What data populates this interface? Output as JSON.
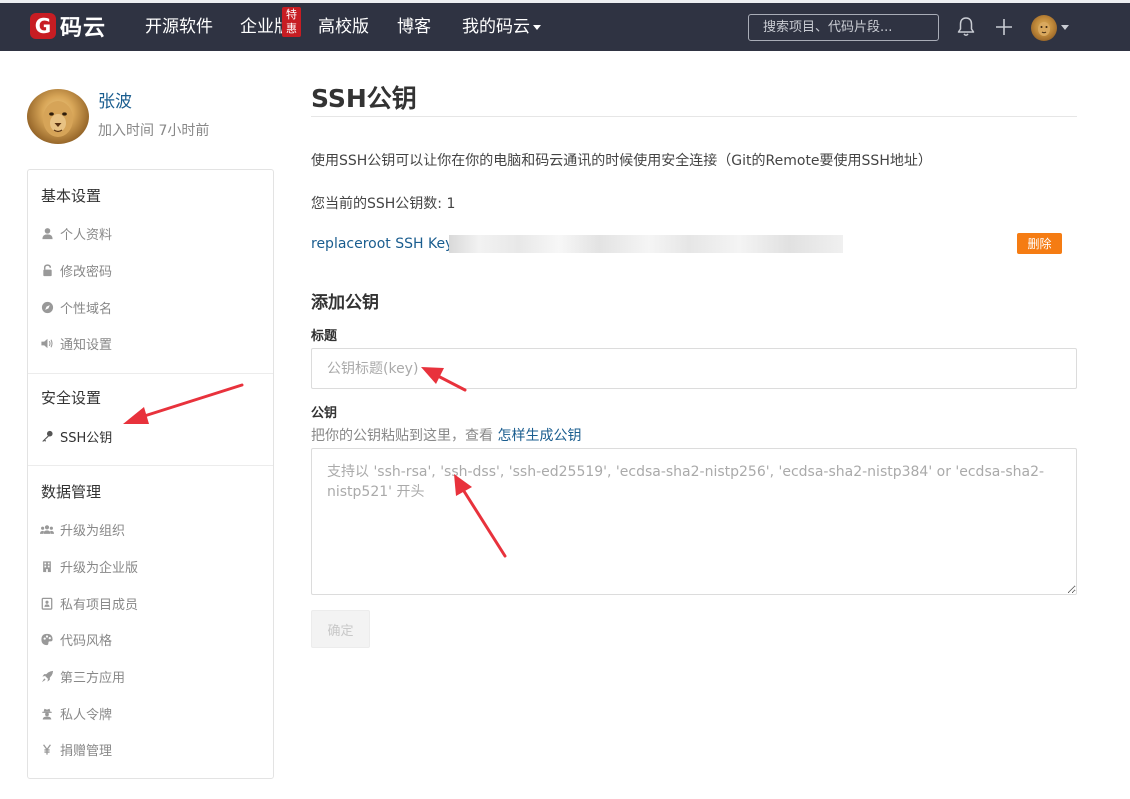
{
  "topbar": {
    "logo_mark": "G",
    "logo_text": "码云",
    "nav": [
      {
        "label": "开源软件"
      },
      {
        "label": "企业版"
      },
      {
        "label": "高校版"
      },
      {
        "label": "博客"
      },
      {
        "label": "我的码云"
      }
    ],
    "badge": "特惠",
    "search_placeholder": "搜索项目、代码片段...",
    "icons": [
      "bell-icon",
      "plus-icon",
      "user-avatar",
      "chevron-down-icon"
    ],
    "colors": {
      "background": "#2f3342",
      "brand": "#c71d23"
    }
  },
  "profile": {
    "name": "张波",
    "joined": "加入时间 7小时前"
  },
  "menu": {
    "groups": [
      {
        "heading": "基本设置",
        "items": [
          {
            "label": "个人资料",
            "icon": "user-icon"
          },
          {
            "label": "修改密码",
            "icon": "lock-icon"
          },
          {
            "label": "个性域名",
            "icon": "compass-icon"
          },
          {
            "label": "通知设置",
            "icon": "volume-icon"
          }
        ]
      },
      {
        "heading": "安全设置",
        "items": [
          {
            "label": "SSH公钥",
            "icon": "key-icon",
            "active": true
          }
        ]
      },
      {
        "heading": "数据管理",
        "items": [
          {
            "label": "升级为组织",
            "icon": "group-icon"
          },
          {
            "label": "升级为企业版",
            "icon": "building-icon"
          },
          {
            "label": "私有项目成员",
            "icon": "member-card-icon"
          },
          {
            "label": "代码风格",
            "icon": "palette-icon"
          },
          {
            "label": "第三方应用",
            "icon": "rocket-icon"
          },
          {
            "label": "私人令牌",
            "icon": "user-secret-icon"
          },
          {
            "label": "捐赠管理",
            "icon": "yen-icon"
          }
        ]
      }
    ]
  },
  "main": {
    "title": "SSH公钥",
    "description": "使用SSH公钥可以让你在你的电脑和码云通讯的时候使用安全连接（Git的Remote要使用SSH地址）",
    "count": "您当前的SSH公钥数: 1",
    "key": {
      "title": "replaceroot SSH Key",
      "fingerprint": "",
      "delete_label": "删除",
      "delete_color": "#f57c13"
    },
    "add_section": {
      "title": "添加公钥",
      "title_label": "标题",
      "title_placeholder": "公钥标题(key)",
      "key_label": "公钥",
      "hint": "把你的公钥粘贴到这里，查看 ",
      "hint_link": "怎样生成公钥",
      "key_placeholder": "支持以 'ssh-rsa', 'ssh-dss', 'ssh-ed25519', 'ecdsa-sha2-nistp256', 'ecdsa-sha2-nistp384' or 'ecdsa-sha2-nistp521' 开头",
      "submit_label": "确定"
    }
  },
  "annotation_color": "#e8323c"
}
